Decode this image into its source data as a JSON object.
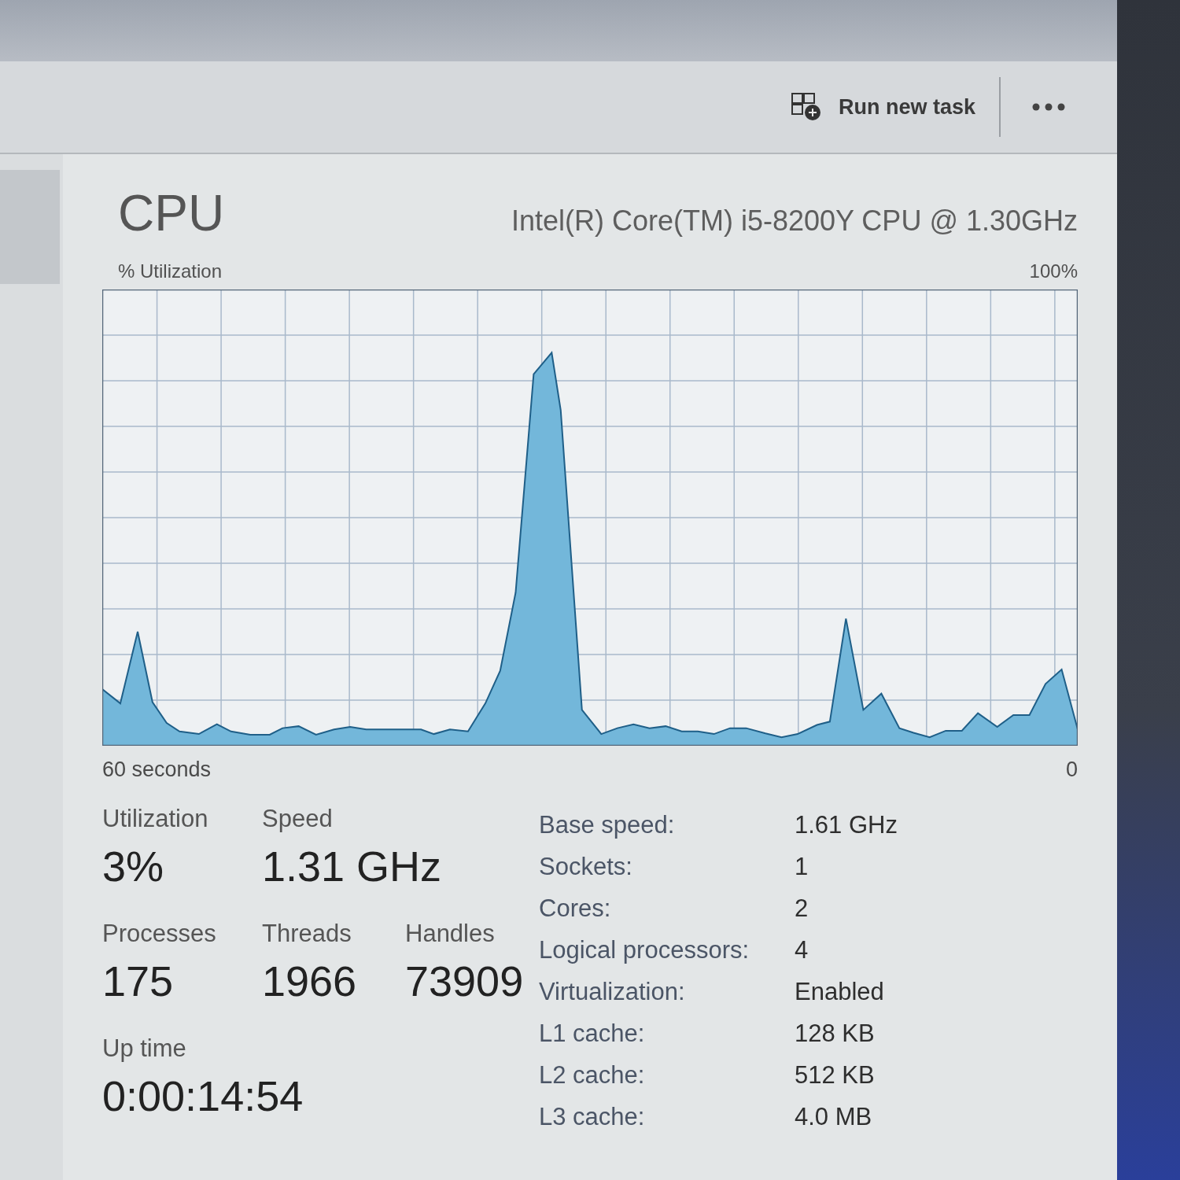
{
  "toolbar": {
    "buttons": [
      {
        "kind": "run",
        "label": "Run new task"
      },
      {
        "kind": "more"
      }
    ]
  },
  "header": {
    "title": "CPU",
    "processor": "Intel(R) Core(TM) i5-8200Y CPU @ 1.30GHz"
  },
  "graph": {
    "y_label": "% Utilization",
    "y_max": "100%",
    "x_start": "60 seconds",
    "x_end": "0"
  },
  "stats": {
    "rows": [
      {
        "items": [
          {
            "label": "Utilization",
            "value": "3%"
          },
          {
            "label": "Speed",
            "value": "1.31 GHz"
          }
        ]
      },
      {
        "items": [
          {
            "label": "Processes",
            "value": "175"
          },
          {
            "label": "Threads",
            "value": "1966"
          },
          {
            "label": "Handles",
            "value": "73909"
          }
        ]
      },
      {
        "items": [
          {
            "label": "Up time",
            "value": "0:00:14:54"
          }
        ]
      }
    ]
  },
  "details": [
    {
      "label": "Base speed:",
      "value": "1.61 GHz"
    },
    {
      "label": "Sockets:",
      "value": "1"
    },
    {
      "label": "Cores:",
      "value": "2"
    },
    {
      "label": "Logical processors:",
      "value": "4"
    },
    {
      "label": "Virtualization:",
      "value": "Enabled"
    },
    {
      "label": "L1 cache:",
      "value": "128 KB"
    },
    {
      "label": "L2 cache:",
      "value": "512 KB"
    },
    {
      "label": "L3 cache:",
      "value": "4.0 MB"
    }
  ]
}
